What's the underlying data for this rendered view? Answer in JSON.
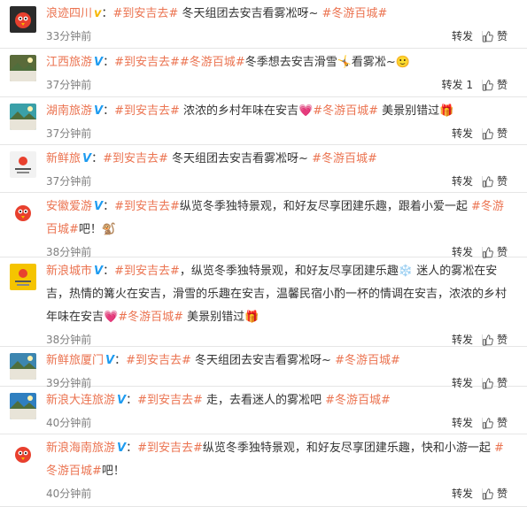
{
  "ui": {
    "repost": "转发",
    "like": "赞"
  },
  "posts": [
    {
      "author": "浪迹四川",
      "verified": "v",
      "text": "：#到安吉去# 冬天组团去安吉看雾凇呀~ #冬游百城#",
      "time": "33分钟前",
      "repost": "转发",
      "avatar": {
        "bg": "#2b2b2b",
        "icon": "bird-avatar-icon"
      }
    },
    {
      "author": "江西旅游",
      "verified": "V",
      "text": "：#到安吉去##冬游百城#冬季想去安吉滑雪🤸看雾凇~🙂",
      "time": "37分钟前",
      "repost": "转发 1",
      "avatar": {
        "bg": "#5a6b3a",
        "icon": "landscape-avatar-icon"
      }
    },
    {
      "author": "湖南旅游",
      "verified": "V",
      "text": "：#到安吉去# 浓浓的乡村年味在安吉💗#冬游百城# 美景别错过🎁",
      "time": "37分钟前",
      "repost": "转发",
      "avatar": {
        "bg": "#3aa0a8",
        "icon": "landscape-avatar-icon"
      }
    },
    {
      "author": "新鲜旅",
      "verified": "V",
      "text": "：#到安吉去# 冬天组团去安吉看雾凇呀~ #冬游百城#",
      "time": "37分钟前",
      "repost": "转发",
      "avatar": {
        "bg": "#f2f2f2",
        "icon": "logo-avatar-icon"
      }
    },
    {
      "author": "安徽爱游",
      "verified": "V",
      "text": "：#到安吉去#纵览冬季独特景观，和好友尽享团建乐趣，跟着小爱一起 #冬游百城#吧！🐒",
      "time": "38分钟前",
      "repost": "转发",
      "avatar": {
        "bg": "#ffffff",
        "icon": "bird-avatar-icon"
      }
    },
    {
      "author": "新浪城市",
      "verified": "V",
      "text": "：#到安吉去#，纵览冬季独特景观，和好友尽享团建乐趣❄️ 迷人的雾凇在安吉，热情的篝火在安吉，滑雪的乐趣在安吉，温馨民宿小酌一杯的情调在安吉，浓浓的乡村年味在安吉💗#冬游百城# 美景别错过🎁",
      "time": "38分钟前",
      "repost": "转发",
      "avatar": {
        "bg": "#f5c400",
        "icon": "logo-avatar-icon"
      }
    },
    {
      "author": "新鲜旅厦门",
      "verified": "V",
      "text": "：#到安吉去# 冬天组团去安吉看雾凇呀~ #冬游百城#",
      "time": "39分钟前",
      "repost": "转发",
      "avatar": {
        "bg": "#3d86b0",
        "icon": "landscape-avatar-icon"
      }
    },
    {
      "author": "新浪大连旅游",
      "verified": "V",
      "text": "：#到安吉去# 走，去看迷人的雾凇吧 #冬游百城#",
      "time": "40分钟前",
      "repost": "转发",
      "avatar": {
        "bg": "#2f7fc0",
        "icon": "landscape-avatar-icon"
      }
    },
    {
      "author": "新浪海南旅游",
      "verified": "V",
      "text": "：#到安吉去#纵览冬季独特景观，和好友尽享团建乐趣，快和小游一起 #冬游百城#吧！",
      "time": "40分钟前",
      "repost": "转发",
      "avatar": {
        "bg": "#ffffff",
        "icon": "bird-avatar-icon"
      }
    }
  ]
}
